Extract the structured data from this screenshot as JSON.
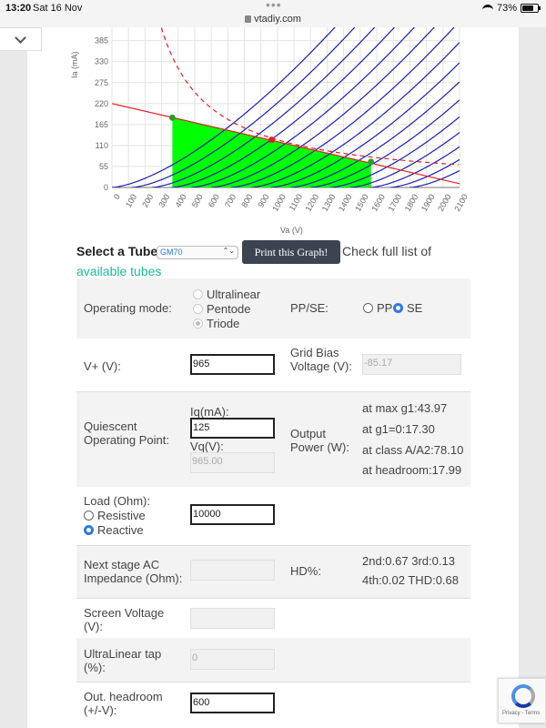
{
  "status_bar": {
    "time": "13:20",
    "date": "Sat 16 Nov",
    "url": "vtadiy.com",
    "battery": "73%"
  },
  "chart_data": {
    "type": "line",
    "xlabel": "Va (V)",
    "ylabel": "Ia (mA)",
    "x_ticks": [
      "0",
      "100",
      "200",
      "300",
      "400",
      "500",
      "600",
      "700",
      "800",
      "900",
      "1000",
      "1100",
      "1200",
      "1300",
      "1400",
      "1500",
      "1600",
      "1700",
      "1800",
      "1900",
      "2000",
      "2100"
    ],
    "y_ticks": [
      "0",
      "55",
      "110",
      "165",
      "220",
      "275",
      "330",
      "385"
    ],
    "xlim": [
      0,
      2100
    ],
    "ylim": [
      0,
      420
    ],
    "grid": true,
    "series": [
      {
        "kind": "plate_curves",
        "color": "#1b1fae",
        "start_voltages": [
          0,
          120,
          240,
          360,
          480,
          600,
          720,
          840,
          960,
          1080,
          1200,
          1320,
          1440,
          1560,
          1680,
          1800
        ],
        "exponent": 1.5,
        "k": 0.0085
      },
      {
        "kind": "load_line",
        "color": "#e02020",
        "points": [
          [
            0,
            220
          ],
          [
            2100,
            10
          ]
        ]
      },
      {
        "kind": "max_dissipation",
        "color": "#e02020",
        "dashed": true,
        "watts": 125
      },
      {
        "kind": "swing_region",
        "color": "#00ff00",
        "x_from": 365,
        "x_to": 1565
      },
      {
        "kind": "markers",
        "points": [
          {
            "x": 365,
            "y": 183,
            "color": "#2e9b2e"
          },
          {
            "x": 965,
            "y": 125,
            "color": "#e02020"
          },
          {
            "x": 1565,
            "y": 67,
            "color": "#2e9b2e"
          }
        ]
      }
    ]
  },
  "selector": {
    "label": "Select a Tube:",
    "tube": "GM70",
    "print_button": "Print this Graph!",
    "check_text": "Check full list of",
    "link_text": "available tubes"
  },
  "table": {
    "operating_mode": {
      "label": "Operating mode:",
      "options": [
        "Ultralinear",
        "Pentode",
        "Triode"
      ],
      "selected": "Triode"
    },
    "pp_se": {
      "label": "PP/SE:",
      "pp": "PP",
      "se": "SE",
      "selected": "SE"
    },
    "v_plus": {
      "label": "V+ (V):",
      "value": "965"
    },
    "grid_bias": {
      "label": "Grid Bias Voltage (V):",
      "value": "-85.17"
    },
    "quiescent": {
      "label": "Quiescent Operating Point:",
      "iq_label": "Iq(mA):",
      "iq_value": "125",
      "vq_label": "Vq(V):",
      "vq_value": "965.00"
    },
    "output_power": {
      "label": "Output Power (W):",
      "max_g1": "at max g1:43.97",
      "g1_zero": "at g1=0:17.30",
      "class_a": "at class A/A2:78.10",
      "headroom": "at headroom:17.99"
    },
    "load": {
      "label": "Load (Ohm):",
      "resistive": "Resistive",
      "reactive": "Reactive",
      "selected": "Reactive",
      "value": "10000"
    },
    "next_stage": {
      "label": "Next stage AC Impedance (Ohm):",
      "value": ""
    },
    "hd": {
      "label": "HD%:",
      "line1": "2nd:0.67 3rd:0.13",
      "line2": "4th:0.02 THD:0.68"
    },
    "screen_voltage": {
      "label": "Screen Voltage (V):",
      "value": ""
    },
    "ul_tap": {
      "label": "UltraLinear tap (%):",
      "value": "0"
    },
    "headroom": {
      "label": "Out. headroom (+/-V):",
      "value": "600"
    }
  },
  "captcha": {
    "text": "Privacy - Terms"
  }
}
